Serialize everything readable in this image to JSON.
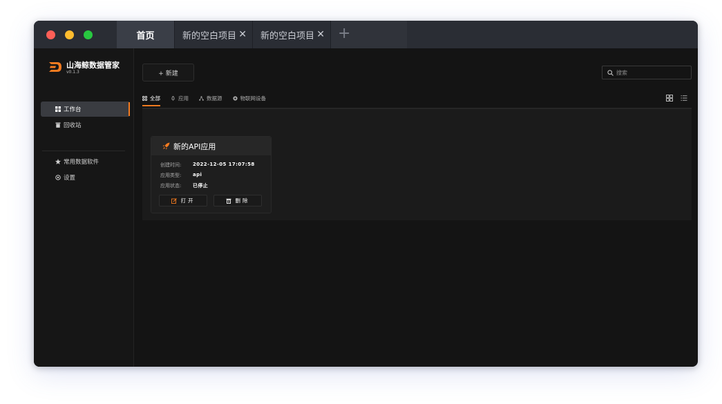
{
  "tabs": {
    "home": "首页",
    "items": [
      "新的空白项目",
      "新的空白项目"
    ],
    "close_glyph": "✕",
    "add_glyph": "+"
  },
  "sidebar": {
    "brand": "山海鲸数据管家",
    "version": "v0.1.3",
    "items": [
      {
        "label": "工作台",
        "icon": "grid-icon"
      },
      {
        "label": "回收站",
        "icon": "trash-icon"
      },
      {
        "label": "常用数据软件",
        "icon": "star-icon"
      },
      {
        "label": "设置",
        "icon": "gear-icon"
      }
    ]
  },
  "toolbar": {
    "new_label": "+ 新建",
    "search_placeholder": "搜索"
  },
  "filters": [
    {
      "label": "全部",
      "icon": "apps-icon"
    },
    {
      "label": "应用",
      "icon": "rocket-icon"
    },
    {
      "label": "数据源",
      "icon": "share-icon"
    },
    {
      "label": "物联网设备",
      "icon": "device-icon"
    }
  ],
  "card": {
    "title": "新的API应用",
    "rows": [
      {
        "key": "创建时间:",
        "value": "2022-12-05 17:07:58"
      },
      {
        "key": "应用类型:",
        "value": "api"
      },
      {
        "key": "应用状态:",
        "value": "已停止"
      }
    ],
    "open_label": "打开",
    "delete_label": "删除"
  },
  "colors": {
    "accent": "#f47b20",
    "background": "#141414",
    "titlebar": "#2a2d34"
  }
}
